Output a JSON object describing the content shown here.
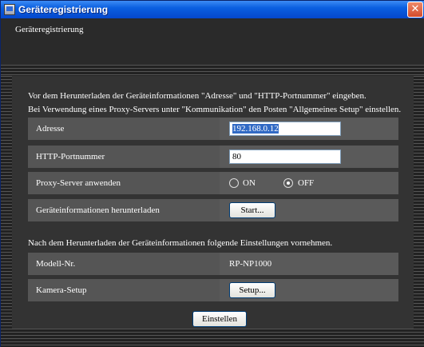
{
  "window": {
    "title": "Geräteregistrierung",
    "close_symbol": "✕"
  },
  "header": {
    "title": "Geräteregistrierung"
  },
  "intro": {
    "line1": "Vor dem Herunterladen der Geräteinformationen \"Adresse\" und \"HTTP-Portnummer\" eingeben.",
    "line2": "Bei Verwendung eines Proxy-Servers unter \"Kommunikation\" den Posten \"Allgemeines Setup\" einstellen."
  },
  "form": {
    "address_label": "Adresse",
    "address_value": "192.168.0.12",
    "port_label": "HTTP-Portnummer",
    "port_value": "80",
    "proxy_label": "Proxy-Server anwenden",
    "proxy_on_label": "ON",
    "proxy_off_label": "OFF",
    "proxy_selected": "OFF",
    "download_label": "Geräteinformationen herunterladen",
    "start_button": "Start..."
  },
  "after": {
    "note": "Nach dem Herunterladen der Geräteinformationen folgende Einstellungen vornehmen.",
    "model_label": "Modell-Nr.",
    "model_value": "RP-NP1000",
    "camera_label": "Kamera-Setup",
    "setup_button": "Setup..."
  },
  "footer": {
    "apply_button": "Einstellen"
  },
  "colors": {
    "titlebar": "#0a5fe0",
    "background": "#333333",
    "row": "#555555"
  }
}
